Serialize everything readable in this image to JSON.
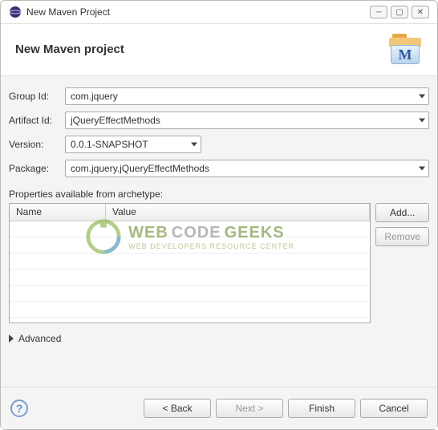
{
  "window": {
    "title": "New Maven Project"
  },
  "header": {
    "title": "New Maven project"
  },
  "fields": {
    "group_label": "Group Id:",
    "group_value": "com.jquery",
    "artifact_label": "Artifact Id:",
    "artifact_value": "jQueryEffectMethods",
    "version_label": "Version:",
    "version_value": "0.0.1-SNAPSHOT",
    "package_label": "Package:",
    "package_value": "com.jquery.jQueryEffectMethods"
  },
  "properties": {
    "section_label": "Properties available from archetype:",
    "col_name": "Name",
    "col_value": "Value"
  },
  "buttons": {
    "add": "Add...",
    "remove": "Remove",
    "back": "< Back",
    "next": "Next >",
    "finish": "Finish",
    "cancel": "Cancel"
  },
  "advanced": {
    "label": "Advanced"
  },
  "watermark": {
    "line1a": "WEB",
    "line1b": "CODE",
    "line1c": "GEEKS",
    "line2": "WEB DEVELOPERS RESOURCE CENTER"
  }
}
